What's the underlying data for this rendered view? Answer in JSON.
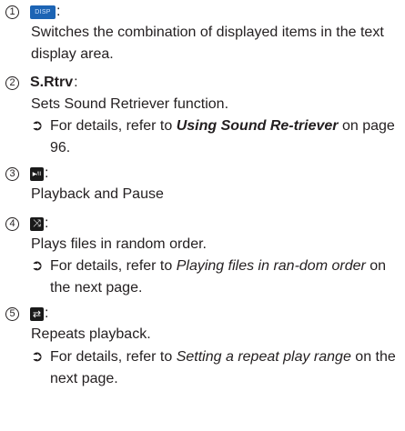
{
  "items": [
    {
      "number": "1",
      "icon": {
        "name": "disp-icon",
        "text": "DISP",
        "color": "#1c64b4"
      },
      "description": "Switches the combination of displayed items in the text display area."
    },
    {
      "number": "2",
      "term": "S.Rtrv",
      "description": "Sets Sound Retriever function.",
      "ref": {
        "prefix": "For details, refer to ",
        "link": "Using Sound Re-triever",
        "suffix": " on page 96."
      }
    },
    {
      "number": "3",
      "icon": {
        "name": "play-pause-icon",
        "text": "▶/II"
      },
      "description": "Playback and Pause"
    },
    {
      "number": "4",
      "icon": {
        "name": "random-icon",
        "text": "⤨"
      },
      "description": "Plays files in random order.",
      "ref": {
        "prefix": "For details, refer to ",
        "link": "Playing files in ran-dom order",
        "suffix": " on the next page."
      }
    },
    {
      "number": "5",
      "icon": {
        "name": "repeat-icon",
        "text": "⇄"
      },
      "description": "Repeats playback.",
      "ref": {
        "prefix": "For details, refer to ",
        "link": "Setting a repeat play range",
        "suffix": " on the next page."
      }
    }
  ],
  "ref_arrow": "➲",
  "colon": ":"
}
